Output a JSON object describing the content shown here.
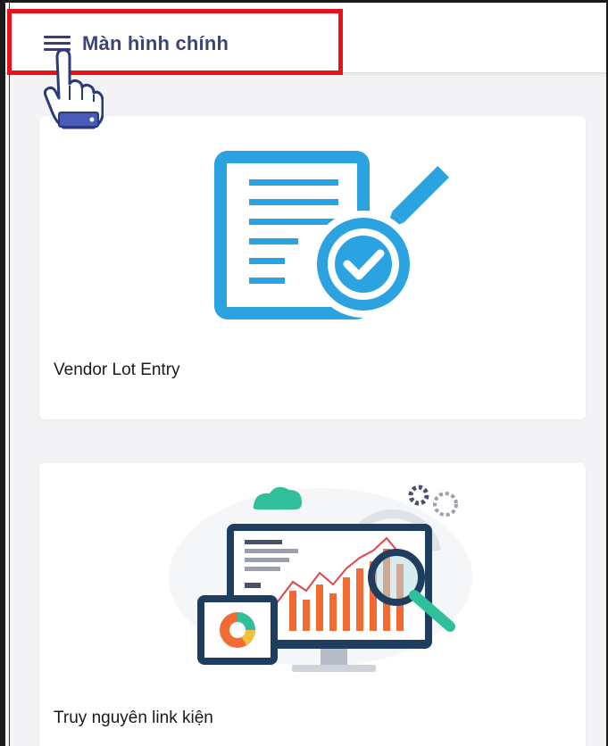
{
  "header": {
    "menu_icon": "hamburger-menu-icon",
    "title": "Màn hình chính"
  },
  "annotation": {
    "highlight_color": "#e8121b",
    "pointer_icon": "pointing-hand-icon"
  },
  "cards": [
    {
      "label": "Vendor Lot Entry",
      "icon": "document-approved-icon"
    },
    {
      "label": "Truy nguyên link kiện",
      "icon": "analytics-dashboard-icon"
    }
  ],
  "colors": {
    "accent": "#2ba3e0",
    "title": "#3f4472"
  }
}
